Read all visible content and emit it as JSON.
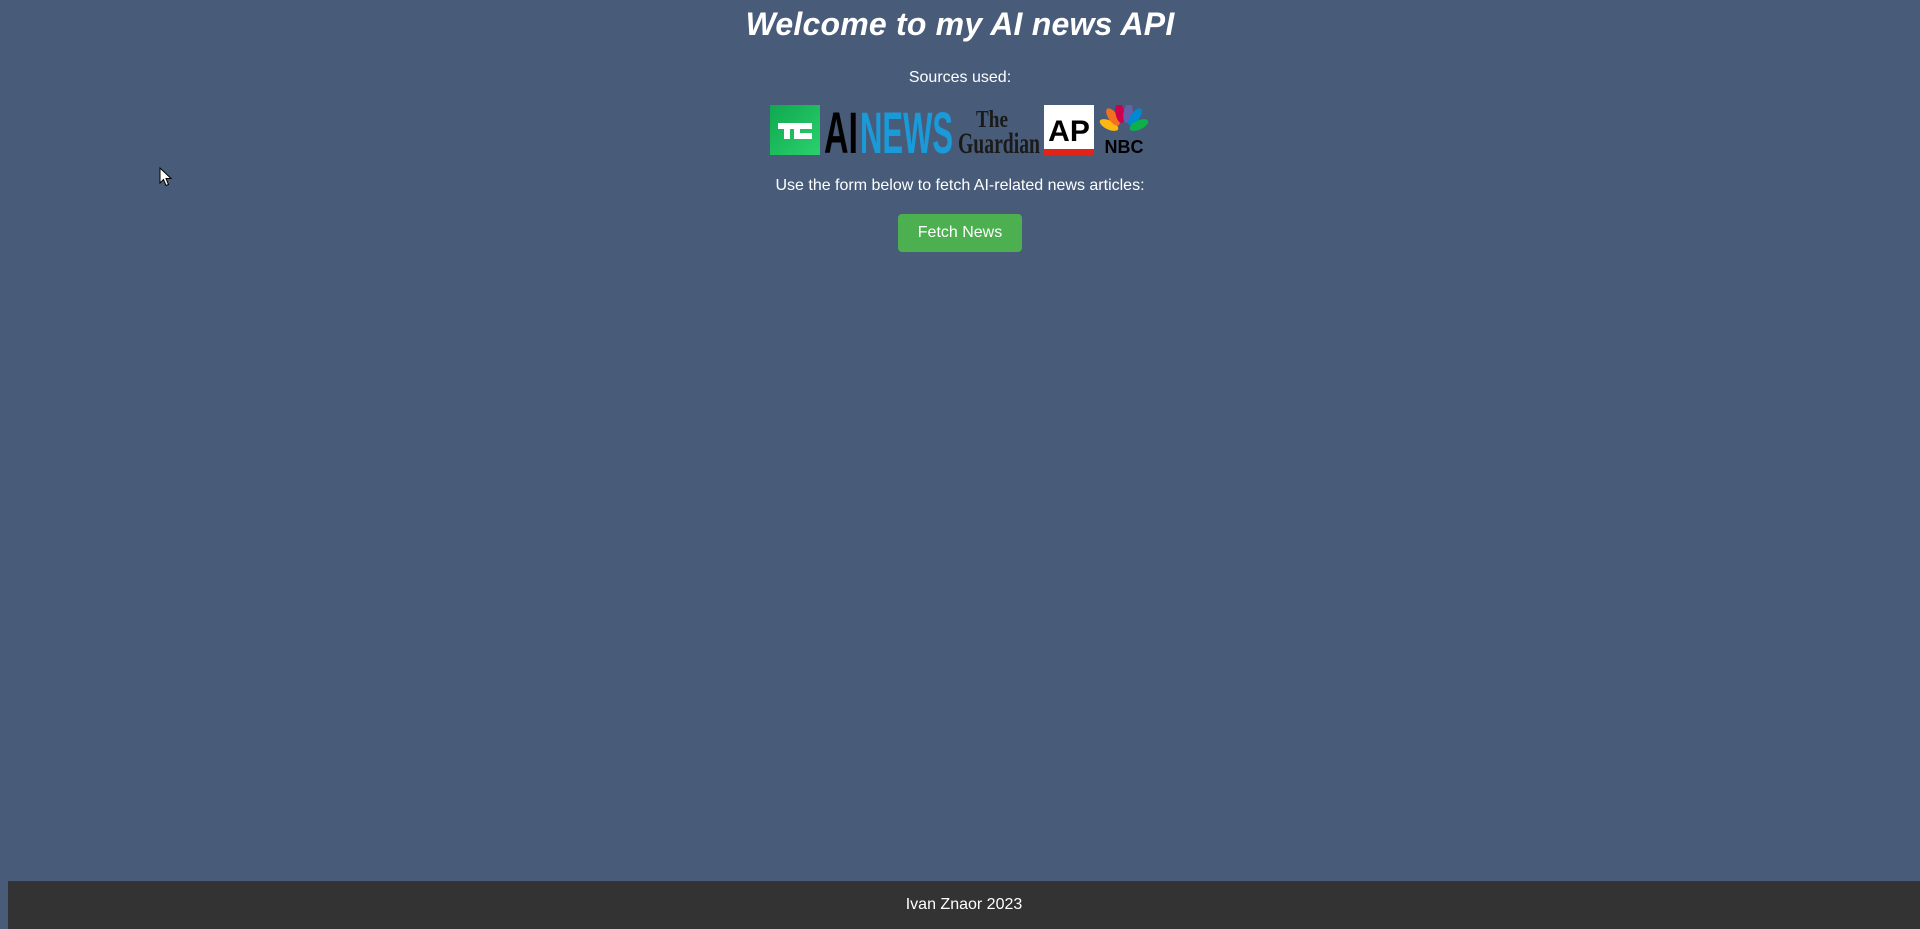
{
  "header": {
    "title": "Welcome to my AI news API",
    "sources_label": "Sources used:"
  },
  "sources": {
    "logos": [
      {
        "icon": "techcrunch-logo-icon",
        "text": "TC",
        "color": "#1dbc5d"
      },
      {
        "icon": "ainews-logo-icon",
        "text_a": "AI",
        "text_b": "NEWS",
        "color_a": "#000000",
        "color_b": "#1a9ad8"
      },
      {
        "icon": "guardian-logo-icon",
        "text_a": "The",
        "text_b": "Guardian",
        "color": "#1a1a1a"
      },
      {
        "icon": "ap-logo-icon",
        "text": "AP",
        "color": "#000000",
        "accent": "#e2231a"
      },
      {
        "icon": "nbc-logo-icon",
        "text": "NBC",
        "color": "#000000"
      }
    ]
  },
  "main": {
    "instructions": "Use the form below to fetch AI-related news articles:",
    "fetch_button_label": "Fetch News"
  },
  "footer": {
    "text": "Ivan Znaor 2023"
  },
  "colors": {
    "background": "#485c7a",
    "button": "#4caf50",
    "footer": "#333333"
  }
}
